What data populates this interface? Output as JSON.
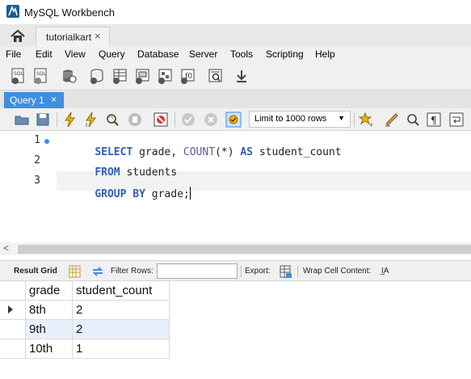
{
  "window": {
    "title": "MySQL Workbench"
  },
  "connection_tabs": [
    {
      "label": "tutorialkart",
      "close": "×"
    }
  ],
  "menu": [
    "File",
    "Edit",
    "View",
    "Query",
    "Database",
    "Server",
    "Tools",
    "Scripting",
    "Help"
  ],
  "main_toolbar": {
    "icons": [
      "new-sql-tab-icon",
      "open-sql-script-icon",
      "inspector-icon",
      "create-schema-icon",
      "create-table-icon",
      "create-view-icon",
      "create-procedure-icon",
      "create-function-icon",
      "search-table-data-icon",
      "reconnect-icon"
    ]
  },
  "query_tabs": [
    {
      "label": "Query 1",
      "close": "×",
      "active": true
    }
  ],
  "editor_toolbar": {
    "icons": [
      "open-file-icon",
      "save-file-icon",
      "execute-icon",
      "execute-current-icon",
      "explain-icon",
      "stop-icon",
      "toggle-error-icon",
      "commit-icon",
      "rollback-icon",
      "autocommit-icon",
      "bookmark-icon",
      "beautify-icon",
      "find-icon",
      "invisible-chars-icon",
      "wrap-icon"
    ],
    "limit_label": "Limit to 1000 rows"
  },
  "editor": {
    "lines": [
      {
        "num": "1",
        "tokens": [
          {
            "t": "SELECT",
            "c": "kw"
          },
          {
            "t": " grade, ",
            "c": ""
          },
          {
            "t": "COUNT",
            "c": "fn"
          },
          {
            "t": "(*) ",
            "c": ""
          },
          {
            "t": "AS",
            "c": "kw"
          },
          {
            "t": " student_count",
            "c": ""
          }
        ]
      },
      {
        "num": "2",
        "tokens": [
          {
            "t": "FROM",
            "c": "kw"
          },
          {
            "t": " students",
            "c": ""
          }
        ]
      },
      {
        "num": "3",
        "tokens": [
          {
            "t": "GROUP BY",
            "c": "kw"
          },
          {
            "t": " grade;",
            "c": ""
          }
        ]
      }
    ],
    "active_line": 3
  },
  "hscroll": {
    "left_arrow": "<"
  },
  "result_toolbar": {
    "result_grid_label": "Result Grid",
    "filter_rows_label": "Filter Rows:",
    "filter_value": "",
    "export_label": "Export:",
    "wrap_label": "Wrap Cell Content:",
    "wrap_icon_text": "I̲A"
  },
  "result_grid": {
    "columns": [
      "grade",
      "student_count"
    ],
    "rows": [
      [
        "8th",
        "2"
      ],
      [
        "9th",
        "2"
      ],
      [
        "10th",
        "1"
      ]
    ],
    "selected_row": 0,
    "highlight_row": 1,
    "highlight_color": "#e8f0fb"
  },
  "colors": {
    "accent": "#3d8fe0",
    "keyword": "#2f5fb3"
  }
}
